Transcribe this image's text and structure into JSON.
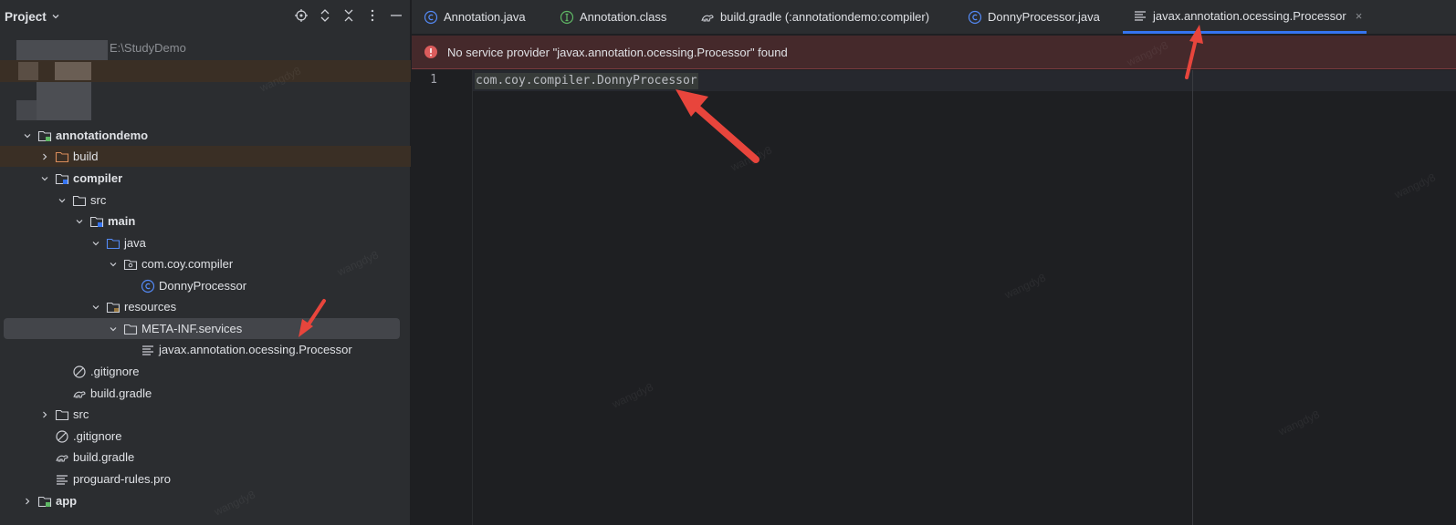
{
  "project_panel": {
    "title": "Project",
    "root_path": "E:\\StudyDemo",
    "tree": [
      {
        "label": "annotationdemo",
        "icon": "module-folder-icon",
        "chevron": "down"
      },
      {
        "label": "build",
        "icon": "folder-excluded-icon",
        "chevron": "right"
      },
      {
        "label": "compiler",
        "icon": "module-folder-icon",
        "chevron": "down"
      },
      {
        "label": "src",
        "icon": "folder-icon",
        "chevron": "down"
      },
      {
        "label": "main",
        "icon": "source-root-icon",
        "chevron": "down"
      },
      {
        "label": "java",
        "icon": "java-source-folder-icon",
        "chevron": "down"
      },
      {
        "label": "com.coy.compiler",
        "icon": "package-icon",
        "chevron": "down"
      },
      {
        "label": "DonnyProcessor",
        "icon": "java-class-icon",
        "chevron": "none"
      },
      {
        "label": "resources",
        "icon": "resources-folder-icon",
        "chevron": "down"
      },
      {
        "label": "META-INF.services",
        "icon": "folder-icon",
        "chevron": "down"
      },
      {
        "label": "javax.annotation.ocessing.Processor",
        "icon": "text-file-icon",
        "chevron": "none"
      },
      {
        "label": ".gitignore",
        "icon": "ignore-file-icon",
        "chevron": "none"
      },
      {
        "label": "build.gradle",
        "icon": "gradle-icon",
        "chevron": "none"
      },
      {
        "label": "src",
        "icon": "folder-icon",
        "chevron": "right"
      },
      {
        "label": ".gitignore",
        "icon": "ignore-file-icon",
        "chevron": "none"
      },
      {
        "label": "build.gradle",
        "icon": "gradle-icon",
        "chevron": "none"
      },
      {
        "label": "proguard-rules.pro",
        "icon": "text-file-icon",
        "chevron": "none"
      },
      {
        "label": "app",
        "icon": "module-folder-icon",
        "chevron": "right"
      }
    ]
  },
  "tabs": [
    {
      "label": "Annotation.java",
      "icon": "java-class-icon"
    },
    {
      "label": "Annotation.class",
      "icon": "annotation-class-icon"
    },
    {
      "label": "build.gradle (:annotationdemo:compiler)",
      "icon": "gradle-icon"
    },
    {
      "label": "DonnyProcessor.java",
      "icon": "java-class-icon"
    },
    {
      "label": "javax.annotation.ocessing.Processor",
      "icon": "text-file-icon",
      "active": true,
      "close": "×"
    }
  ],
  "banner": {
    "message": "No service provider \"javax.annotation.ocessing.Processor\" found",
    "icon": "error-icon"
  },
  "editor": {
    "line_number": "1",
    "code": "com.coy.compiler.DonnyProcessor"
  },
  "watermark": "wangdy8",
  "colors": {
    "accent": "#3574f0",
    "error": "#db5c5c",
    "arrow": "#e8453c"
  }
}
